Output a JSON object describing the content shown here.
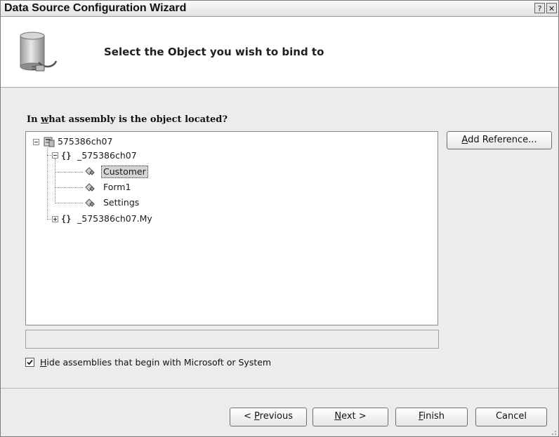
{
  "window": {
    "title": "Data Source Configuration Wizard",
    "help_glyph": "?",
    "close_glyph": "✕"
  },
  "header": {
    "heading": "Select the Object you wish to bind to",
    "icon": "database-plug-icon"
  },
  "question": {
    "prefix": "In ",
    "accel": "w",
    "suffix": "hat assembly is the object located?"
  },
  "tree": {
    "root": {
      "label": "575386ch07",
      "icon": "assembly-icon",
      "expanded": true
    },
    "namespace": {
      "brace": "{}",
      "label": "_575386ch07",
      "expanded": true
    },
    "classes": [
      {
        "label": "Customer",
        "icon": "class-icon",
        "selected": true
      },
      {
        "label": "Form1",
        "icon": "class-icon",
        "selected": false
      },
      {
        "label": "Settings",
        "icon": "class-icon",
        "selected": false
      }
    ],
    "namespace2": {
      "brace": "{}",
      "label": "_575386ch07.My",
      "expanded": false
    }
  },
  "add_reference": {
    "accel": "A",
    "rest": "dd Reference..."
  },
  "checkbox": {
    "checked": true,
    "check_glyph": "✓",
    "accel": "H",
    "rest": "ide assemblies that begin with Microsoft or System"
  },
  "buttons": {
    "previous": {
      "pre": "< ",
      "accel": "P",
      "rest": "revious"
    },
    "next": {
      "accel": "N",
      "rest": "ext >"
    },
    "finish": {
      "accel": "F",
      "rest": "inish"
    },
    "cancel": {
      "label": "Cancel"
    }
  }
}
